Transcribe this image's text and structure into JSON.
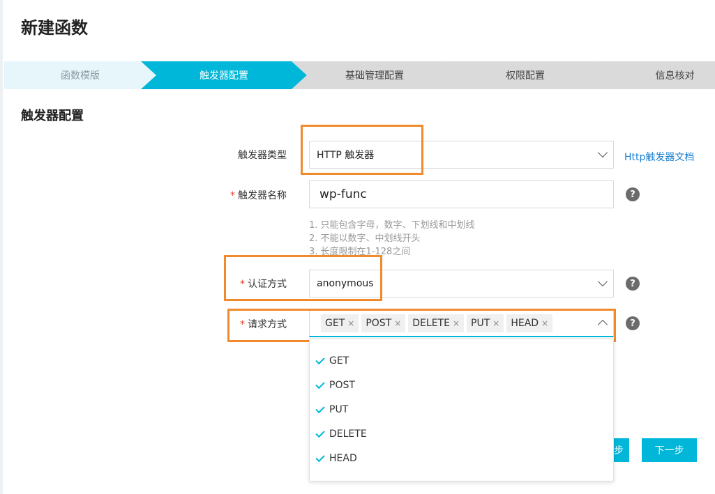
{
  "page": {
    "title": "新建函数"
  },
  "steps": [
    {
      "label": "函数模版",
      "state": "done"
    },
    {
      "label": "触发器配置",
      "state": "active"
    },
    {
      "label": "基础管理配置",
      "state": "todo"
    },
    {
      "label": "权限配置",
      "state": "todo"
    },
    {
      "label": "信息核对",
      "state": "todo"
    }
  ],
  "section": {
    "title": "触发器配置"
  },
  "form": {
    "trigger_type": {
      "label": "触发器类型",
      "value": "HTTP 触发器",
      "doc_link": "Http触发器文档"
    },
    "trigger_name": {
      "label": "触发器名称",
      "value": "wp-func",
      "required_mark": "*",
      "help": "?"
    },
    "hints": [
      "1. 只能包含字母，数字、下划线和中划线",
      "2. 不能以数字、中划线开头",
      "3. 长度限制在1-128之间"
    ],
    "auth": {
      "label": "认证方式",
      "value": "anonymous",
      "required_mark": "*",
      "help": "?"
    },
    "methods": {
      "label": "请求方式",
      "required_mark": "*",
      "help": "?",
      "selected": [
        "GET",
        "POST",
        "DELETE",
        "PUT",
        "HEAD"
      ],
      "remove_icon": "×",
      "options": [
        "GET",
        "POST",
        "PUT",
        "DELETE",
        "HEAD"
      ]
    }
  },
  "buttons": {
    "prev_partial": "步",
    "next": "下一步"
  },
  "colors": {
    "accent": "#00b7d9",
    "highlight": "#f08a2c",
    "link": "#1a7fcf",
    "required": "#e0442a"
  }
}
